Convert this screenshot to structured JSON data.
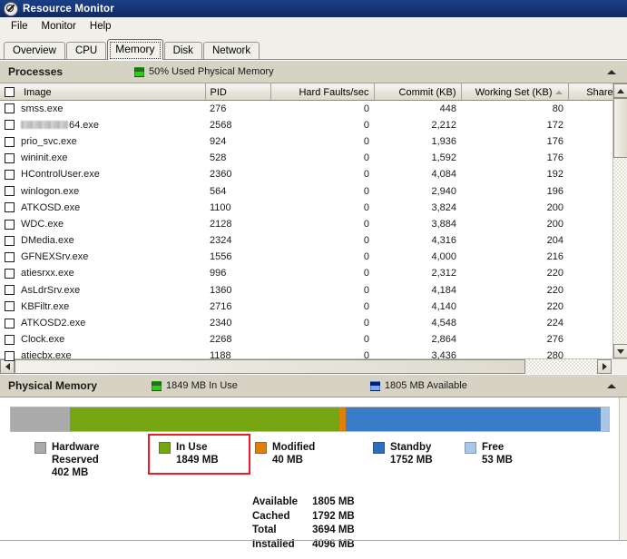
{
  "window": {
    "title": "Resource Monitor",
    "icon": "resource-monitor-icon"
  },
  "menu": {
    "items": [
      {
        "label": "File"
      },
      {
        "label": "Monitor"
      },
      {
        "label": "Help"
      }
    ]
  },
  "tabs": {
    "selected": "Memory",
    "items": [
      {
        "label": "Overview"
      },
      {
        "label": "CPU"
      },
      {
        "label": "Memory"
      },
      {
        "label": "Disk"
      },
      {
        "label": "Network"
      }
    ]
  },
  "processes": {
    "title": "Processes",
    "status_label": "50% Used Physical Memory",
    "status_swatch_color": "#23d117",
    "collapse_icon": "chevron-up-icon",
    "columns": [
      {
        "label": "Image",
        "align": "l"
      },
      {
        "label": "PID",
        "align": "l"
      },
      {
        "label": "Hard Faults/sec",
        "align": "r"
      },
      {
        "label": "Commit (KB)",
        "align": "r"
      },
      {
        "label": "Working Set (KB)",
        "align": "r",
        "sort": "asc"
      },
      {
        "label": "Shareable (K",
        "align": "r"
      }
    ],
    "rows": [
      {
        "image": "smss.exe",
        "pid": "276",
        "hard_faults": "0",
        "commit": "448",
        "working_set": "80",
        "redacted": false
      },
      {
        "image": "64.exe",
        "pid": "2568",
        "hard_faults": "0",
        "commit": "2,212",
        "working_set": "172",
        "redacted": true
      },
      {
        "image": "prio_svc.exe",
        "pid": "924",
        "hard_faults": "0",
        "commit": "1,936",
        "working_set": "176",
        "redacted": false
      },
      {
        "image": "wininit.exe",
        "pid": "528",
        "hard_faults": "0",
        "commit": "1,592",
        "working_set": "176",
        "redacted": false
      },
      {
        "image": "HControlUser.exe",
        "pid": "2360",
        "hard_faults": "0",
        "commit": "4,084",
        "working_set": "192",
        "redacted": false
      },
      {
        "image": "winlogon.exe",
        "pid": "564",
        "hard_faults": "0",
        "commit": "2,940",
        "working_set": "196",
        "redacted": false
      },
      {
        "image": "ATKOSD.exe",
        "pid": "1100",
        "hard_faults": "0",
        "commit": "3,824",
        "working_set": "200",
        "redacted": false
      },
      {
        "image": "WDC.exe",
        "pid": "2128",
        "hard_faults": "0",
        "commit": "3,884",
        "working_set": "200",
        "redacted": false
      },
      {
        "image": "DMedia.exe",
        "pid": "2324",
        "hard_faults": "0",
        "commit": "4,316",
        "working_set": "204",
        "redacted": false
      },
      {
        "image": "GFNEXSrv.exe",
        "pid": "1556",
        "hard_faults": "0",
        "commit": "4,000",
        "working_set": "216",
        "redacted": false
      },
      {
        "image": "atiesrxx.exe",
        "pid": "996",
        "hard_faults": "0",
        "commit": "2,312",
        "working_set": "220",
        "redacted": false
      },
      {
        "image": "AsLdrSrv.exe",
        "pid": "1360",
        "hard_faults": "0",
        "commit": "4,184",
        "working_set": "220",
        "redacted": false
      },
      {
        "image": "KBFiltr.exe",
        "pid": "2716",
        "hard_faults": "0",
        "commit": "4,140",
        "working_set": "220",
        "redacted": false
      },
      {
        "image": "ATKOSD2.exe",
        "pid": "2340",
        "hard_faults": "0",
        "commit": "4,548",
        "working_set": "224",
        "redacted": false
      },
      {
        "image": "Clock.exe",
        "pid": "2268",
        "hard_faults": "0",
        "commit": "2,864",
        "working_set": "276",
        "redacted": false
      },
      {
        "image": "atiecbx.exe",
        "pid": "1188",
        "hard_faults": "0",
        "commit": "3,436",
        "working_set": "280",
        "redacted": false
      }
    ]
  },
  "physical_memory": {
    "title": "Physical Memory",
    "in_use_label": "1849 MB In Use",
    "available_label": "1805 MB Available",
    "collapse_icon": "chevron-up-icon",
    "chart_data": {
      "type": "bar",
      "title": "Physical Memory",
      "orientation": "horizontal-stacked",
      "unit": "MB",
      "total_installed": 4096,
      "categories": [
        "Hardware Reserved",
        "In Use",
        "Modified",
        "Standby",
        "Free"
      ],
      "values": [
        402,
        1849,
        40,
        1752,
        53
      ],
      "colors": [
        "#aaaaaa",
        "#76a512",
        "#dd8009",
        "#3a7cc7",
        "#a8c6e8"
      ]
    },
    "legend": [
      {
        "name": "Hardware",
        "name2": "Reserved",
        "value": "402 MB",
        "color": "#aaaaaa",
        "highlighted": false
      },
      {
        "name": "In Use",
        "name2": "",
        "value": "1849 MB",
        "color": "#76a512",
        "highlighted": true
      },
      {
        "name": "Modified",
        "name2": "",
        "value": "40 MB",
        "color": "#dd8009",
        "highlighted": false
      },
      {
        "name": "Standby",
        "name2": "",
        "value": "1752 MB",
        "color": "#2c6fc2",
        "highlighted": false
      },
      {
        "name": "Free",
        "name2": "",
        "value": "53 MB",
        "color": "#a8c6e8",
        "highlighted": false
      }
    ],
    "stats": [
      {
        "key": "Available",
        "value": "1805 MB"
      },
      {
        "key": "Cached",
        "value": "1792 MB"
      },
      {
        "key": "Total",
        "value": "3694 MB"
      },
      {
        "key": "Installed",
        "value": "4096 MB"
      }
    ],
    "highlight_color": "#ee1c22"
  }
}
